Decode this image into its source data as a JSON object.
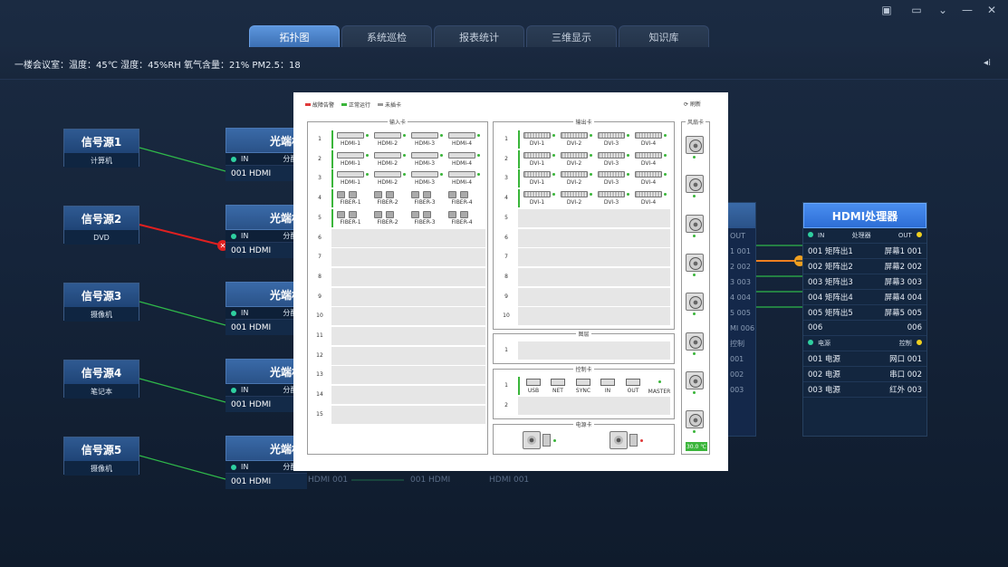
{
  "tabs": [
    "拓扑图",
    "系统巡检",
    "报表统计",
    "三维显示",
    "知识库"
  ],
  "environment": "一楼会议室：温度：45℃   湿度：45%RH   氧气含量：21%   PM2.5：18",
  "sources": [
    {
      "name": "信号源1",
      "device": "计算机"
    },
    {
      "name": "信号源2",
      "device": "DVD"
    },
    {
      "name": "信号源3",
      "device": "摄像机"
    },
    {
      "name": "信号源4",
      "device": "笔记本"
    },
    {
      "name": "信号源5",
      "device": "摄像机"
    }
  ],
  "optical": {
    "title": "光端机",
    "in": "IN",
    "dist": "分配器",
    "port": "001 HDMI"
  },
  "faint_row": [
    "HDMI 001",
    "001 HDMI",
    "HDMI 001"
  ],
  "processor": {
    "title": "HDMI处理器",
    "hdr_in": "IN",
    "hdr_mid": "处理器",
    "hdr_out": "OUT",
    "rows": [
      {
        "l": "001 矩阵出1",
        "r": "屏幕1 001"
      },
      {
        "l": "002 矩阵出2",
        "r": "屏幕2 002"
      },
      {
        "l": "003 矩阵出3",
        "r": "屏幕3 003"
      },
      {
        "l": "004 矩阵出4",
        "r": "屏幕4 004"
      },
      {
        "l": "005 矩阵出5",
        "r": "屏幕5 005"
      },
      {
        "l": "006",
        "r": "006"
      }
    ],
    "power_hdr": "电源",
    "ctrl_hdr": "控制",
    "power_rows": [
      {
        "l": "001 电源",
        "r": "网口 001"
      },
      {
        "l": "002 电源",
        "r": "串口 002"
      },
      {
        "l": "003 电源",
        "r": "红外 003"
      }
    ]
  },
  "behind": [
    "OUT",
    "1 001",
    "2 002",
    "3 003",
    "4 004",
    "5 005",
    "MI 006",
    "控制",
    "001",
    "002",
    "003"
  ],
  "modal": {
    "legend": [
      {
        "label": "故障告警",
        "color": "#e03a3a"
      },
      {
        "label": "正常运行",
        "color": "#3ab53a"
      },
      {
        "label": "未插卡",
        "color": "#999999"
      }
    ],
    "refresh": "刷新",
    "input_title": "输入卡",
    "output_title": "输出卡",
    "fan_title": "风扇卡",
    "frame_title": "图层",
    "control_title": "控制卡",
    "power_title": "电源卡",
    "slot_numbers": [
      "1",
      "2",
      "3",
      "4",
      "5",
      "6",
      "7",
      "8",
      "9",
      "10",
      "11",
      "12",
      "13",
      "14",
      "15"
    ],
    "hdmi_labels": [
      "HDMI-1",
      "HDMI-2",
      "HDMI-3",
      "HDMI-4"
    ],
    "fiber_labels": [
      "FIBER-1",
      "FIBER-2",
      "FIBER-3",
      "FIBER-4"
    ],
    "dvi_labels": [
      "DVI-1",
      "DVI-2",
      "DVI-3",
      "DVI-4"
    ],
    "control_items": [
      "USB",
      "NET",
      "SYNC",
      "IN",
      "OUT",
      "MASTER"
    ],
    "temperature": "30.0 ℃"
  },
  "colors": {
    "accent": "#3b6fb3",
    "ok": "#3ab53a",
    "alarm": "#e03a3a",
    "warn": "#f0a020"
  }
}
